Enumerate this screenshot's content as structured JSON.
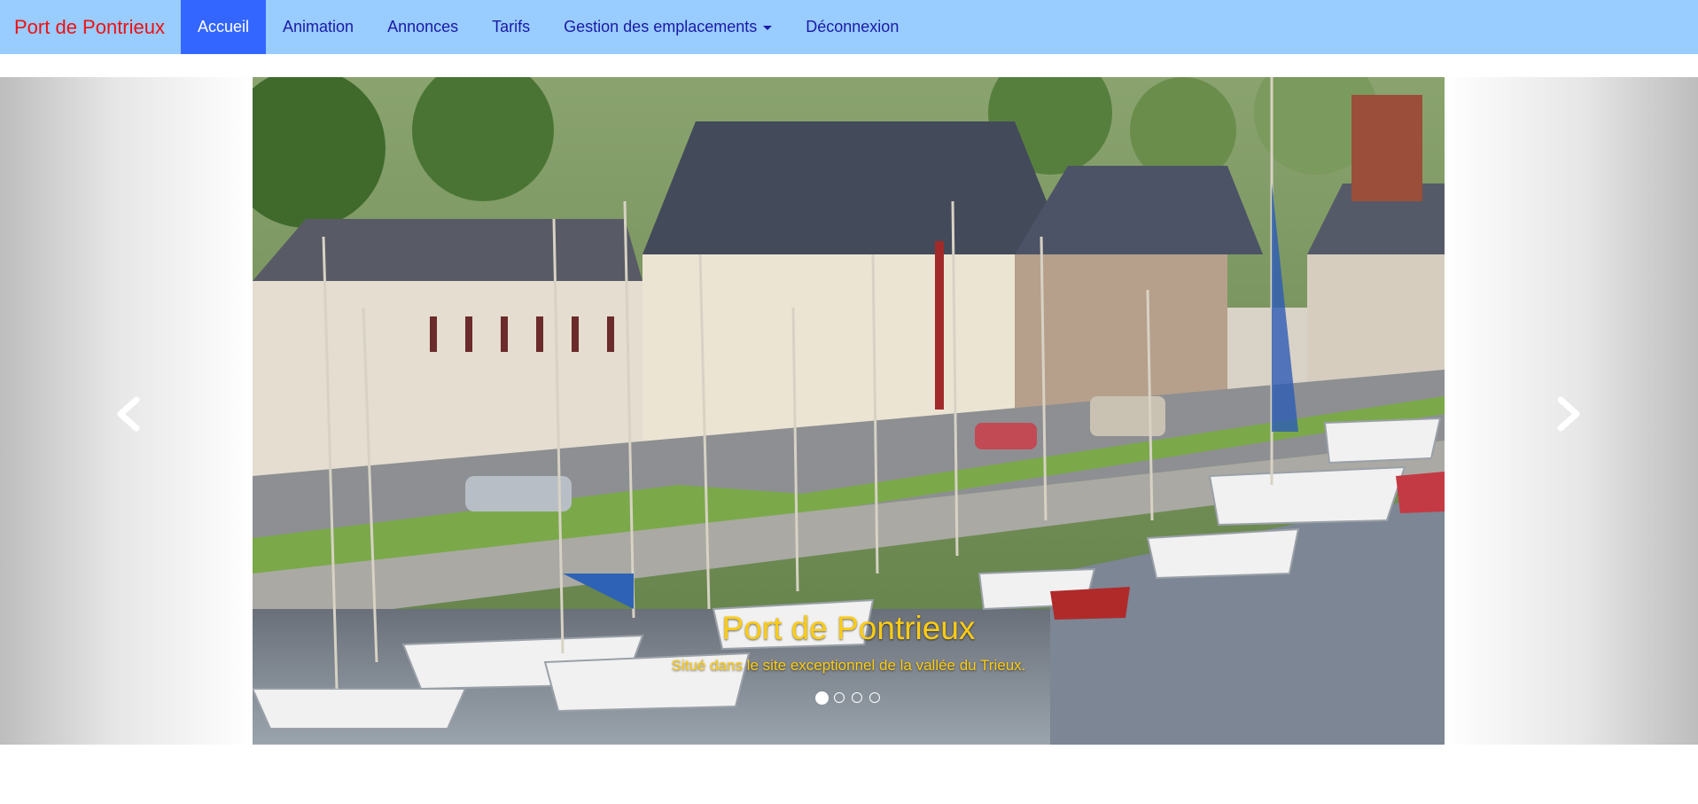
{
  "navbar": {
    "brand": "Port de Pontrieux",
    "items": [
      {
        "label": "Accueil",
        "active": true
      },
      {
        "label": "Animation",
        "active": false
      },
      {
        "label": "Annonces",
        "active": false
      },
      {
        "label": "Tarifs",
        "active": false
      },
      {
        "label": "Gestion des emplacements",
        "active": false,
        "dropdown": true
      },
      {
        "label": "Déconnexion",
        "active": false
      }
    ]
  },
  "carousel": {
    "caption_title": "Port de Pontrieux",
    "caption_text": "Situé dans le site exceptionnel de la vallée du Trieux.",
    "slide_count": 4,
    "active_slide": 1,
    "prev_icon": "chevron-left-icon",
    "next_icon": "chevron-right-icon"
  },
  "colors": {
    "navbar_bg": "#99ccff",
    "brand": "#ee1111",
    "nav_link": "#1a1aa6",
    "active_bg": "#3366ff",
    "caption": "#ffcc11"
  }
}
